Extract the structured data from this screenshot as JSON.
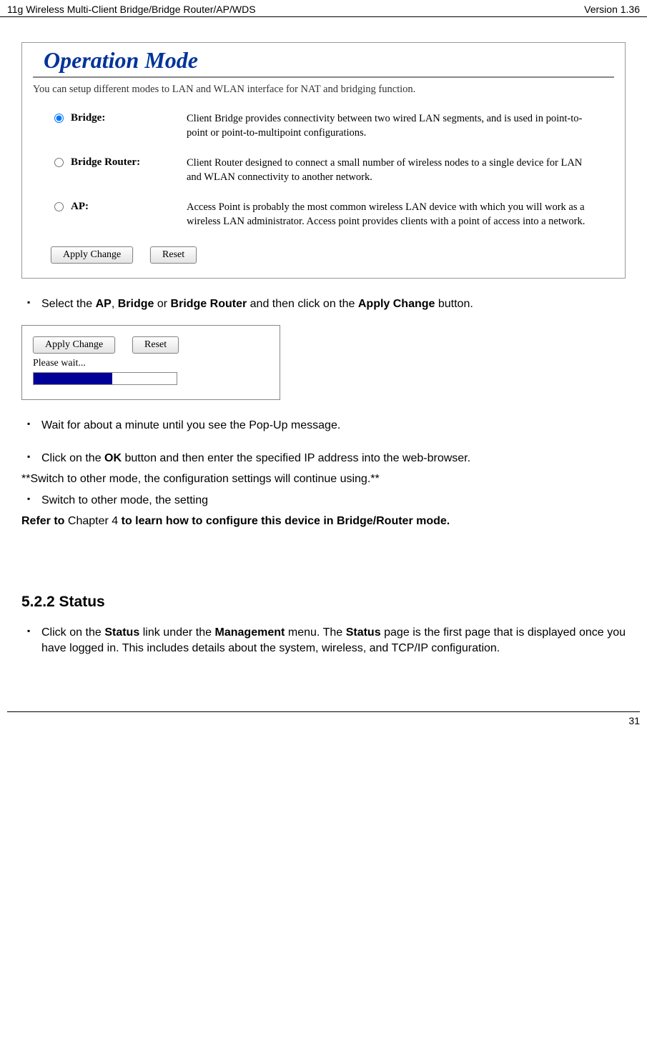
{
  "header": {
    "left": "11g Wireless Multi-Client Bridge/Bridge Router/AP/WDS",
    "right": "Version 1.36"
  },
  "op_panel": {
    "title": "Operation Mode",
    "intro": "You can setup different modes to LAN and WLAN interface for NAT and bridging function.",
    "options": [
      {
        "label": "Bridge:",
        "checked": true,
        "desc": "Client Bridge provides connectivity between two wired LAN segments, and is used in point-to-point or point-to-multipoint configurations."
      },
      {
        "label": "Bridge Router:",
        "desc": "Client Router designed to connect a small number of wireless nodes to a single device for LAN and WLAN connectivity to another network."
      },
      {
        "label": "AP:",
        "desc": "Access Point is probably the most common wireless LAN device with which you will work as a wireless LAN administrator. Access point provides clients with a point of access into a network."
      }
    ],
    "apply_btn": "Apply Change",
    "reset_btn": "Reset"
  },
  "bullet_select": {
    "pre": "Select the ",
    "b1": "AP",
    "mid1": ", ",
    "b2": "Bridge",
    "mid2": " or ",
    "b3": "Bridge Router",
    "mid3": " and then click on the ",
    "b4": "Apply Change",
    "post": " button."
  },
  "small_shot": {
    "apply_btn": "Apply Change",
    "reset_btn": "Reset",
    "please": "Please wait..."
  },
  "bullet_wait": "Wait for about a minute until you see the Pop-Up message.",
  "bullet_ok": {
    "pre": "Click on the ",
    "b1": "OK",
    "post": " button and then enter the specified IP address into the web-browser."
  },
  "line_switch_note": "**Switch to other mode, the configuration settings will continue using.**",
  "bullet_switch": "Switch to other mode, the setting",
  "refer_line": {
    "b1": "Refer to ",
    "mid": "Chapter 4 ",
    "b2": "to learn how to configure this device in Bridge/Router mode."
  },
  "section_heading": "5.2.2  Status",
  "bullet_status": {
    "pre": "Click on the ",
    "b1": "Status",
    "mid1": " link under the ",
    "b2": "Management",
    "mid2": " menu. The ",
    "b3": "Status",
    "post": " page is the first page that is displayed once you have logged in. This includes details about the system, wireless, and TCP/IP configuration."
  },
  "page_number": "31"
}
